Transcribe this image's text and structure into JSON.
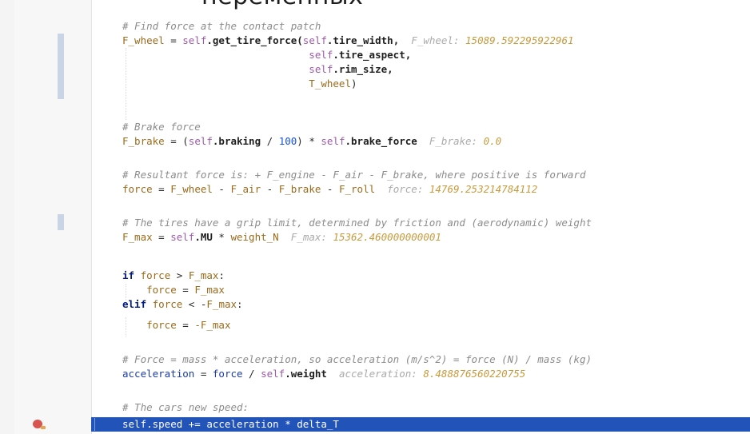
{
  "overlay_title": "переменных",
  "code": {
    "comment_contact": "# Find force at the contact patch",
    "f_wheel_var": "F_wheel",
    "eq": " = ",
    "self": "self",
    "get_tire_force": ".get_tire_force(",
    "tire_width": ".tire_width,",
    "tire_aspect": ".tire_aspect,",
    "rim_size": ".rim_size,",
    "t_wheel": "T_wheel",
    "close_paren": ")",
    "hint_f_wheel_label": "F_wheel:",
    "hint_f_wheel_value": "15089.592295922961",
    "comment_brake": "# Brake force",
    "f_brake_var": "F_brake",
    "brake_open": " = (",
    "braking": ".braking",
    "div": " / ",
    "num_100": "100",
    "mul_close": ") * ",
    "brake_force": ".brake_force",
    "hint_f_brake_label": "F_brake:",
    "hint_f_brake_value": "0.0",
    "comment_resultant": "# Resultant force is: + F_engine - F_air - F_brake, where positive is forward",
    "force_var": "force",
    "f_wheel": "F_wheel",
    "minus": " - ",
    "f_air": "F_air",
    "f_brake": "F_brake",
    "f_roll": "F_roll",
    "hint_force_label": "force:",
    "hint_force_value": "14769.253214784112",
    "comment_grip": "# The tires have a grip limit, determined by friction and (aerodynamic) weight",
    "f_max_var": "F_max",
    "mu": ".MU",
    "mul": " * ",
    "weight_n": "weight_N",
    "hint_f_max_label": "F_max:",
    "hint_f_max_value": "15362.460000000001",
    "kw_if": "if",
    "gt": " > ",
    "colon": ":",
    "f_max": "F_max",
    "kw_elif": "elif",
    "lt_neg": " < -",
    "assign": " = ",
    "neg_f_max": "-F_max",
    "comment_accel": "# Force = mass * acceleration, so acceleration (m/s^2) = force (N) / mass (kg)",
    "acceleration_var": "acceleration",
    "force": "force",
    "weight": ".weight",
    "hint_accel_label": "acceleration:",
    "hint_accel_value": "8.488876560220755",
    "comment_speed": "# The cars new speed:",
    "current_line": "self.speed += acceleration * delta_T"
  }
}
